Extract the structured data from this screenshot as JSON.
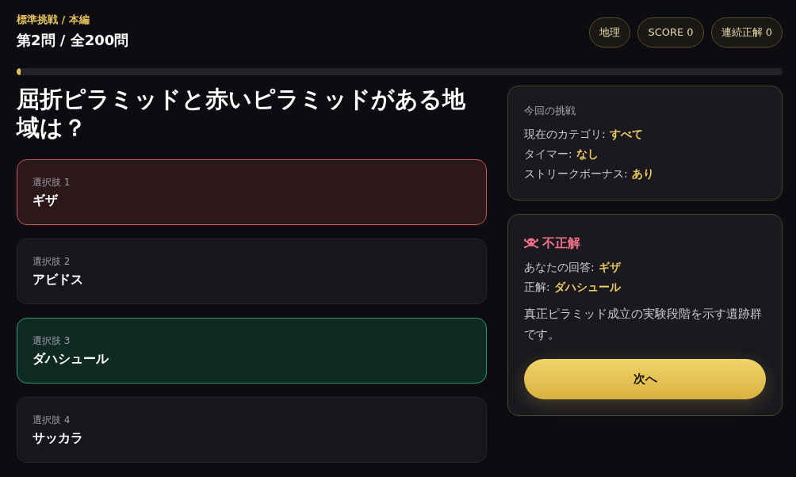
{
  "header": {
    "mode": "標準挑戦 / 本編",
    "counter": "第2問 / 全200問",
    "chips": [
      "地理",
      "SCORE 0",
      "連続正解 0"
    ]
  },
  "progress": {
    "level": 0.005
  },
  "question": "屈折ピラミッドと赤いピラミッドがある地域は？",
  "options": [
    {
      "label": "選択肢 1",
      "text": "ギザ",
      "selected": true,
      "correct": false
    },
    {
      "label": "選択肢 2",
      "text": "アビドス",
      "selected": false,
      "correct": false
    },
    {
      "label": "選択肢 3",
      "text": "ダハシュール",
      "selected": false,
      "correct": true
    },
    {
      "label": "選択肢 4",
      "text": "サッカラ",
      "selected": false,
      "correct": false
    }
  ],
  "challenge": {
    "title": "今回の挑戦",
    "rows": [
      {
        "label": "現在のカテゴリ:",
        "value": "すべて"
      },
      {
        "label": "タイマー:",
        "value": "なし"
      },
      {
        "label": "ストリークボーナス:",
        "value": "あり"
      }
    ]
  },
  "feedback": {
    "correct": false,
    "verdict": "不正解",
    "rows": [
      {
        "label": "あなたの回答:",
        "value": "ギザ"
      },
      {
        "label": "正解:",
        "value": "ダハシュール"
      }
    ],
    "explanation": "真正ピラミッド成立の実験段階を示す遺跡群です。",
    "button": "次へ"
  }
}
